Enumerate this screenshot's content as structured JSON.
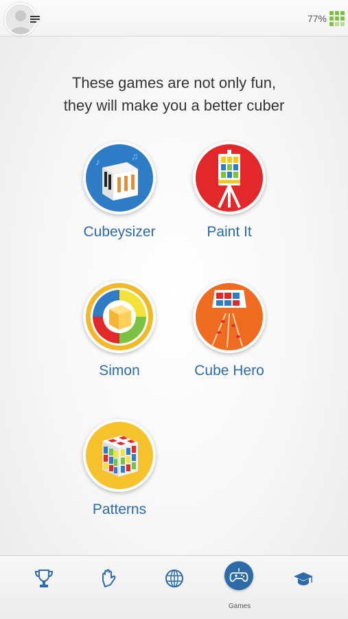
{
  "header": {
    "progress_text": "77%",
    "icons": [
      "avatar",
      "menu-icon",
      "cube-progress-icon"
    ]
  },
  "headline": {
    "line1": "These games are not only fun,",
    "line2": "they will make you a better cuber"
  },
  "games": [
    {
      "label": "Cubeysizer",
      "icon": "piano-cube-icon"
    },
    {
      "label": "Paint It",
      "icon": "easel-icon"
    },
    {
      "label": "Simon",
      "icon": "simon-cube-icon"
    },
    {
      "label": "Cube Hero",
      "icon": "cube-hero-icon"
    },
    {
      "label": "Patterns",
      "icon": "patterns-cube-icon"
    }
  ],
  "tabbar": {
    "tabs": [
      {
        "icon": "trophy-icon",
        "label": ""
      },
      {
        "icon": "glove-icon",
        "label": ""
      },
      {
        "icon": "globe-cube-icon",
        "label": ""
      },
      {
        "icon": "gamepad-icon",
        "label": "Games",
        "active": true
      },
      {
        "icon": "graduation-cap-icon",
        "label": ""
      }
    ]
  },
  "colors": {
    "accent": "#2c6aa8",
    "progress_green": "#7cc242"
  }
}
